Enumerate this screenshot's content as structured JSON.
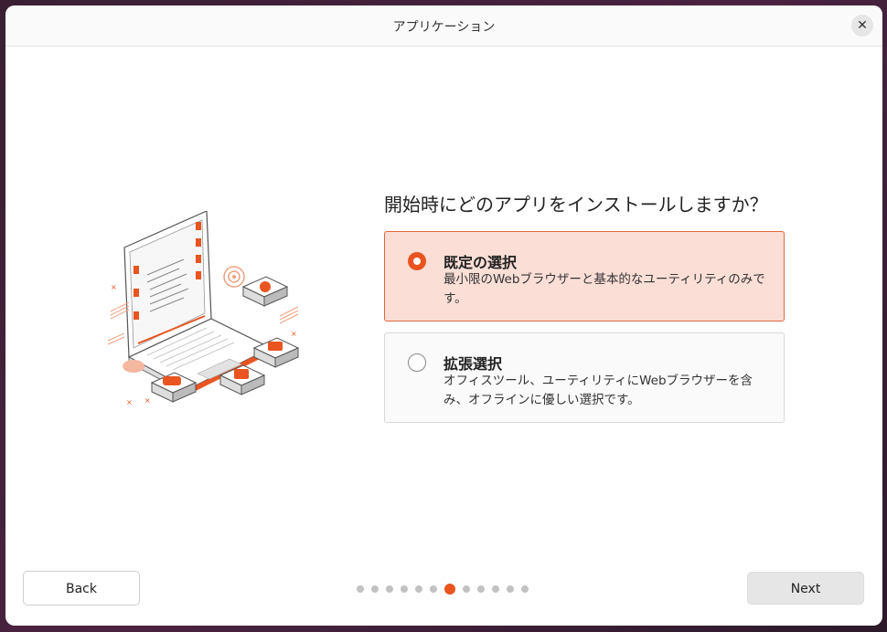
{
  "window": {
    "title": "アプリケーション",
    "close_icon": "close-icon"
  },
  "main": {
    "question": "開始時にどのアプリをインストールしますか？",
    "options": [
      {
        "title": "既定の選択",
        "description": "最小限のWebブラウザーと基本的なユーティリティのみです。",
        "selected": true
      },
      {
        "title": "拡張選択",
        "description": "オフィスツール、ユーティリティにWebブラウザーを含み、オフラインに優しい選択です。",
        "selected": false
      }
    ]
  },
  "footer": {
    "back_label": "Back",
    "next_label": "Next",
    "progress": {
      "total_steps": 12,
      "current_step": 7
    }
  },
  "colors": {
    "accent": "#e95420",
    "selected_bg": "#fbdfd7",
    "selected_border": "#e0653d"
  }
}
